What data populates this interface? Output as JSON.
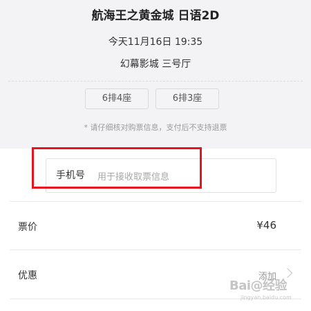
{
  "ticket": {
    "movie_title": "航海王之黄金城 日语2D",
    "showtime": "今天11月16日 19:35",
    "cinema": "幻幕影城 三号厅",
    "seats": [
      "6排4座",
      "6排3座"
    ],
    "notice": "* 请仔细核对购票信息，支付后不支持退票"
  },
  "phone": {
    "label": "手机号",
    "placeholder": "用于接收取票信息",
    "value": ""
  },
  "price_row": {
    "label": "票价",
    "value": "¥46"
  },
  "discount_row": {
    "label": "优惠",
    "value": "添加",
    "icon": "chevron-right-icon"
  },
  "watermark": {
    "text": "Bai@经验",
    "sub": "jingyan.baidu.com"
  },
  "colors": {
    "card_bg": "#f3f3f5",
    "highlight": "#e5151f"
  }
}
